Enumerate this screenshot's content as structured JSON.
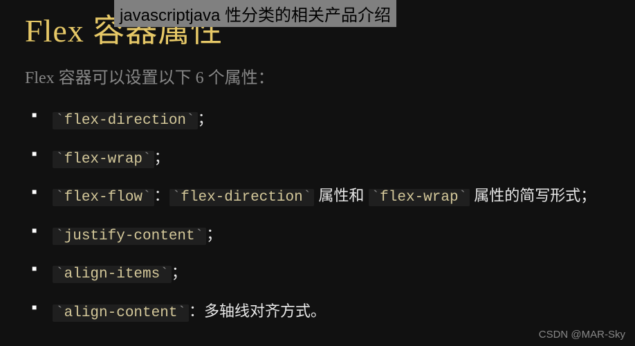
{
  "overlay": {
    "text": "javascriptjava 性分类的相关产品介绍"
  },
  "heading": "Flex 容器属性",
  "subtitle": "Flex 容器可以设置以下 6 个属性：",
  "items": [
    {
      "codes": [
        "flex-direction"
      ],
      "parts": [],
      "suffix": "；"
    },
    {
      "codes": [
        "flex-wrap"
      ],
      "parts": [],
      "suffix": "；"
    },
    {
      "codes": [
        "flex-flow",
        "flex-direction",
        "flex-wrap"
      ],
      "parts": [
        "：",
        " 属性和 ",
        " 属性的简写形式；"
      ],
      "suffix": ""
    },
    {
      "codes": [
        "justify-content"
      ],
      "parts": [],
      "suffix": "；"
    },
    {
      "codes": [
        "align-items"
      ],
      "parts": [],
      "suffix": "；"
    },
    {
      "codes": [
        "align-content"
      ],
      "parts": [
        "：多轴线对齐方式。"
      ],
      "suffix": ""
    }
  ],
  "watermark": "CSDN @MAR-Sky"
}
